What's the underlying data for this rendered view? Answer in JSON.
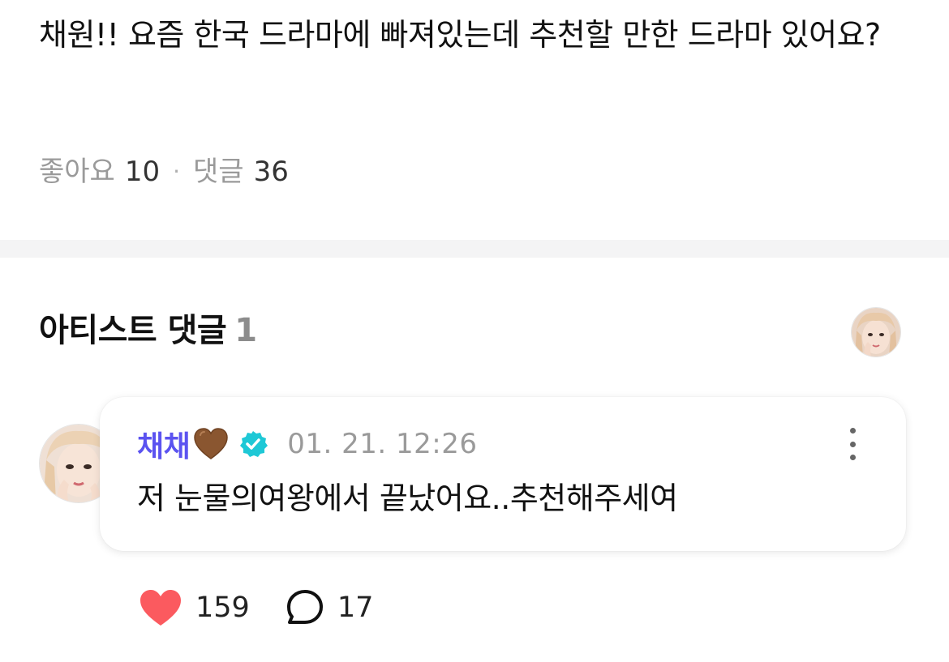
{
  "post": {
    "text": "채원!! 요즘 한국 드라마에 빠져있는데 추천할 만한 드라마 있어요?",
    "likes_label": "좋아요",
    "likes_count": "10",
    "separator": "·",
    "comments_label": "댓글",
    "comments_count": "36"
  },
  "artist_section": {
    "title": "아티스트 댓글",
    "count": "1"
  },
  "comment": {
    "author": "채채",
    "author_emoji": "brown-heart-icon",
    "verified_icon": "verified-badge-icon",
    "timestamp": "01. 21. 12:26",
    "text": "저 눈물의여왕에서 끝났어요..추천해주세여",
    "likes": "159",
    "replies": "17"
  },
  "colors": {
    "author": "#5b53f0",
    "verified": "#1ec8d6",
    "like_heart": "#fb5a5f",
    "brown_heart": "#8a5630",
    "divider": "#f4f4f5"
  }
}
